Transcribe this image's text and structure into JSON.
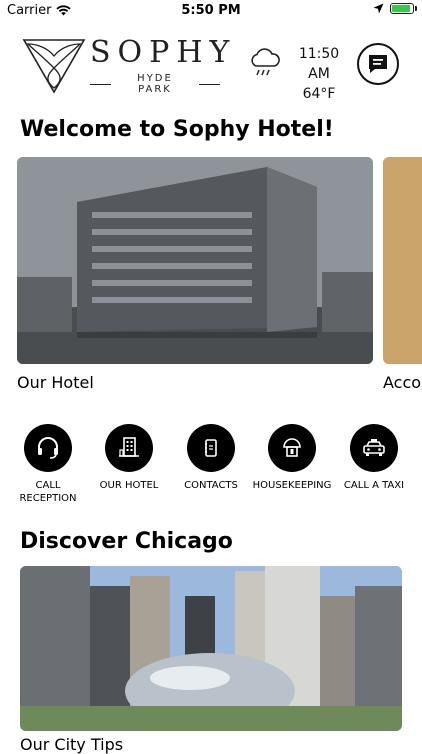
{
  "status_bar": {
    "carrier": "Carrier",
    "time": "5:50 PM",
    "battery_level": 0.9,
    "battery_color": "#3bc84a"
  },
  "header": {
    "brand_name": "SOPHY",
    "brand_location": "HYDE PARK",
    "weather_icon": "rain-cloud-icon",
    "weather_time": "11:50 AM",
    "weather_temp": "64°F",
    "chat_icon": "chat-bubble-icon"
  },
  "welcome_title": "Welcome to Sophy Hotel!",
  "carousel": [
    {
      "label": "Our Hotel"
    },
    {
      "label": "Accor"
    }
  ],
  "quick_actions": [
    {
      "label": "CALL RECEPTION",
      "icon": "headset-icon"
    },
    {
      "label": "OUR HOTEL",
      "icon": "building-icon"
    },
    {
      "label": "CONTACTS",
      "icon": "contacts-book-icon"
    },
    {
      "label": "HOUSEKEEPING",
      "icon": "housekeeping-icon"
    },
    {
      "label": "CALL A TAXI",
      "icon": "taxi-icon"
    }
  ],
  "discover": {
    "title": "Discover Chicago",
    "card_label": "Our City Tips"
  },
  "colors": {
    "background": "#ffffff",
    "text": "#000000",
    "action_circle": "#000000"
  }
}
